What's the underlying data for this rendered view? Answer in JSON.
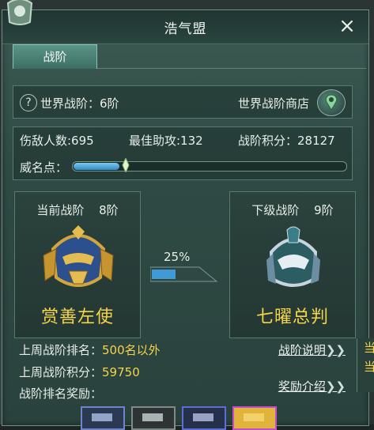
{
  "window": {
    "title": "浩气盟"
  },
  "tabs": [
    {
      "label": "战阶"
    }
  ],
  "world_rank": {
    "label": "世界战阶：6阶",
    "shop": "世界战阶商店",
    "help_icon": "?"
  },
  "stats": {
    "kills": "伤敌人数:695",
    "assists": "最佳助攻:132",
    "points": "战阶积分：28127",
    "fame_label": "威名点：",
    "fame_fraction": 0.17
  },
  "current_rank": {
    "label": "当前战阶",
    "level": "8阶",
    "title": "赏善左使"
  },
  "next_rank": {
    "label": "下级战阶",
    "level": "9阶",
    "title": "七曜总判"
  },
  "progress": {
    "percent_text": "25%",
    "fraction": 0.25
  },
  "footer": {
    "last_week_rank_label": "上周战阶排名：",
    "last_week_rank_value": "500名以外",
    "last_week_points_label": "上周战阶积分：",
    "last_week_points_value": "59750",
    "reward_label": "战阶排名奖励：",
    "link_rank_info": "战阶说明",
    "link_reward_info": "奖励介绍",
    "chevrons": "❯❯"
  },
  "side_panel": {
    "line1": "当",
    "line2": "当"
  },
  "colors": {
    "accent_yellow": "#f6d44a",
    "bar_blue": "#2f8cc4",
    "panel_green": "#2f4a44"
  },
  "icons": [
    "close-icon",
    "help-icon",
    "map-pin-icon",
    "helmet-icon",
    "reward-item-icon"
  ]
}
